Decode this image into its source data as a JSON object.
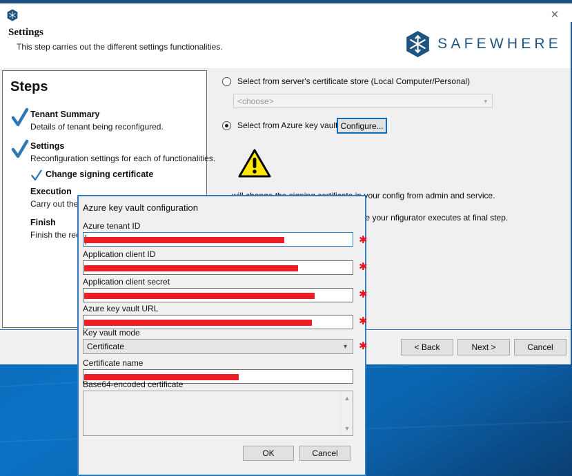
{
  "window": {
    "app_icon": "safewhere-hex-icon",
    "close_label": "✕"
  },
  "header": {
    "title": "Settings",
    "subtitle": "This step carries out the different settings functionalities.",
    "brand": "SAFEWHERE"
  },
  "steps": {
    "heading": "Steps",
    "items": [
      {
        "title": "Tenant Summary",
        "desc": "Details of tenant being reconfigured.",
        "checked": true,
        "sub": false
      },
      {
        "title": "Settings",
        "desc": "Reconfiguration settings for each of functionalities.",
        "checked": true,
        "sub": false
      },
      {
        "title": "Change signing certificate",
        "desc": "",
        "checked": true,
        "sub": true
      },
      {
        "title": "Execution",
        "desc": "Carry out the reconfiguration.",
        "checked": false,
        "sub": false
      },
      {
        "title": "Finish",
        "desc": "Finish the reconfiguration.",
        "checked": false,
        "sub": false
      }
    ]
  },
  "content": {
    "option_store_label": "Select from server's certificate store (Local Computer/Personal)",
    "store_select_value": "<choose>",
    "option_keyvault_label": "Select from Azure key vault",
    "configure_button": "Configure...",
    "warning_paragraph_1": "will change the signing certificate in your config from admin and service.",
    "warning_paragraph_2": "les will be removed, so please ensure your nfigurator executes at final step."
  },
  "footer": {
    "back": "< Back",
    "next": "Next >",
    "cancel": "Cancel"
  },
  "dialog": {
    "title": "Azure key vault configuration",
    "fields": [
      {
        "label": "Azure tenant ID",
        "value": "",
        "required": true,
        "redacted_width": 290,
        "focused": true
      },
      {
        "label": "Application client ID",
        "value": "",
        "required": true,
        "redacted_width": 310,
        "focused": false
      },
      {
        "label": "Application client secret",
        "value": "",
        "required": true,
        "redacted_width": 334,
        "focused": false
      },
      {
        "label": "Azure key vault URL",
        "value": "",
        "required": true,
        "redacted_width": 330,
        "focused": false
      }
    ],
    "kv_mode_label": "Key vault mode",
    "kv_mode_value": "Certificate",
    "kv_mode_required": true,
    "cert_name_label": "Certificate name",
    "cert_name_redacted_width": 224,
    "b64_label": "Base64-encoded certificate",
    "b64_value": "",
    "ok": "OK",
    "cancel": "Cancel"
  },
  "colors": {
    "brand_blue": "#1d5480",
    "accent_blue": "#2d7cc4",
    "title_accent": "#1f4f82",
    "redaction_red": "#ee1c25",
    "required_red": "#e8121c",
    "warning_yellow": "#ffe600",
    "check_blue": "#2e79b5",
    "desktop_blue": "#0a72c4"
  }
}
